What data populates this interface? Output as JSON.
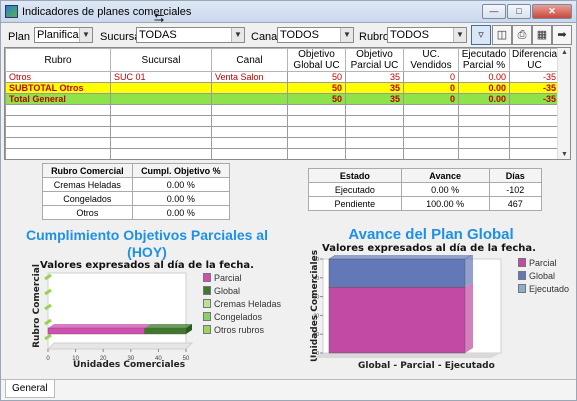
{
  "window": {
    "title": "Indicadores de planes comerciales"
  },
  "filters": {
    "plan_label": "Plan :",
    "plan_value": "Planificación",
    "sucursal_label": "Sucursal :",
    "sucursal_value": "TODAS",
    "canal_label": "Canal :",
    "canal_value": "TODOS",
    "rubro_label": "Rubro :",
    "rubro_value": "TODOS"
  },
  "grid": {
    "columns": [
      "Rubro",
      "Sucursal",
      "Canal",
      "Objetivo Global UC",
      "Objetivo Parcial UC",
      "UC. Vendidos",
      "Ejecutado Parcial %",
      "Diferencia UC"
    ],
    "rows": [
      {
        "style": "normal",
        "cells": [
          "Otros",
          "SUC 01",
          "Venta Salon",
          "50",
          "35",
          "0",
          "0.00",
          "-35"
        ]
      },
      {
        "style": "yellow",
        "cells": [
          "SUBTOTAL Otros",
          "",
          "",
          "50",
          "35",
          "0",
          "0.00",
          "-35"
        ]
      },
      {
        "style": "green",
        "cells": [
          "Total General",
          "",
          "",
          "50",
          "35",
          "0",
          "0.00",
          "-35"
        ]
      }
    ]
  },
  "rubro_table": {
    "headers": [
      "Rubro Comercial",
      "Cumpl. Objetivo %"
    ],
    "rows": [
      [
        "Cremas Heladas",
        "0.00 %"
      ],
      [
        "Congelados",
        "0.00 %"
      ],
      [
        "Otros",
        "0.00 %"
      ]
    ]
  },
  "estado_table": {
    "headers": [
      "Estado",
      "Avance",
      "Días"
    ],
    "rows": [
      [
        "Ejecutado",
        "0.00 %",
        "-102"
      ],
      [
        "Pendiente",
        "100.00 %",
        "467"
      ]
    ]
  },
  "chart_data": [
    {
      "type": "bar",
      "orientation": "horizontal",
      "title": "Cumplimiento Objetivos Parciales al (HOY)",
      "subtitle": "Valores expresados al día de la fecha.",
      "xlabel": "Unidades Comerciales",
      "ylabel": "Rubro Comercial",
      "xlim": [
        0,
        50
      ],
      "xticks": [
        "0",
        "10",
        "20",
        "30",
        "40",
        "50"
      ],
      "series": [
        {
          "name": "Parcial",
          "color": "#d04fb0",
          "values": [
            35
          ]
        },
        {
          "name": "Global",
          "color": "#3f7a2c",
          "values": [
            15
          ]
        },
        {
          "name": "Cremas Heladas",
          "color": "#b7e39a",
          "values": []
        },
        {
          "name": "Congelados",
          "color": "#8ccf6a",
          "values": []
        },
        {
          "name": "Otros rubros",
          "color": "#9dd35e",
          "values": []
        }
      ]
    },
    {
      "type": "bar",
      "orientation": "vertical",
      "title": "Avance del Plan Global",
      "subtitle": "Valores expresados al día de la fecha.",
      "xlabel": "Global - Parcial - Ejecutado",
      "ylabel": "Unidades Comerciales",
      "ylim": [
        0,
        50
      ],
      "yticks": [
        "0",
        "10",
        "20",
        "30",
        "40",
        "50"
      ],
      "series": [
        {
          "name": "Parcial",
          "color": "#c24aa4",
          "values": [
            35
          ]
        },
        {
          "name": "Global",
          "color": "#6378b6",
          "values": [
            15
          ]
        },
        {
          "name": "Ejecutado",
          "color": "#8aaed0",
          "values": [
            0
          ]
        }
      ]
    }
  ],
  "status": {
    "tab_label": "General"
  }
}
